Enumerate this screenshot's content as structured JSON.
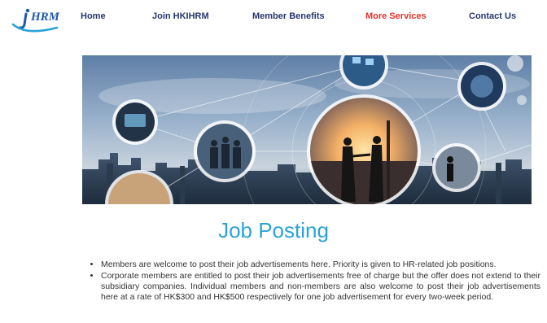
{
  "logo": {
    "text": "HRM",
    "icon": "hkihrm-swoosh-logo"
  },
  "nav": {
    "items": [
      {
        "label": "Home"
      },
      {
        "label": "Join HKIHRM"
      },
      {
        "label": "Member Benefits"
      },
      {
        "label": "More Services",
        "active": true
      },
      {
        "label": "Contact Us"
      }
    ]
  },
  "colors": {
    "nav_text": "#27356b",
    "nav_active": "#e0322c",
    "title": "#2aa3d9",
    "body_text": "#333333"
  },
  "banner": {
    "description_icon": "business-network-banner-image"
  },
  "main": {
    "title": "Job Posting",
    "bullets": [
      "Members are welcome to post their job advertisements here. Priority is given to HR-related job positions.",
      "Corporate members are entitled to post their job advertisements free of charge but the offer does not extend to their subsidiary companies. Individual members and non-members are also welcome to post their job advertisements here at a rate of HK$300 and HK$500 respectively for one job advertisement for every two-week period."
    ]
  }
}
